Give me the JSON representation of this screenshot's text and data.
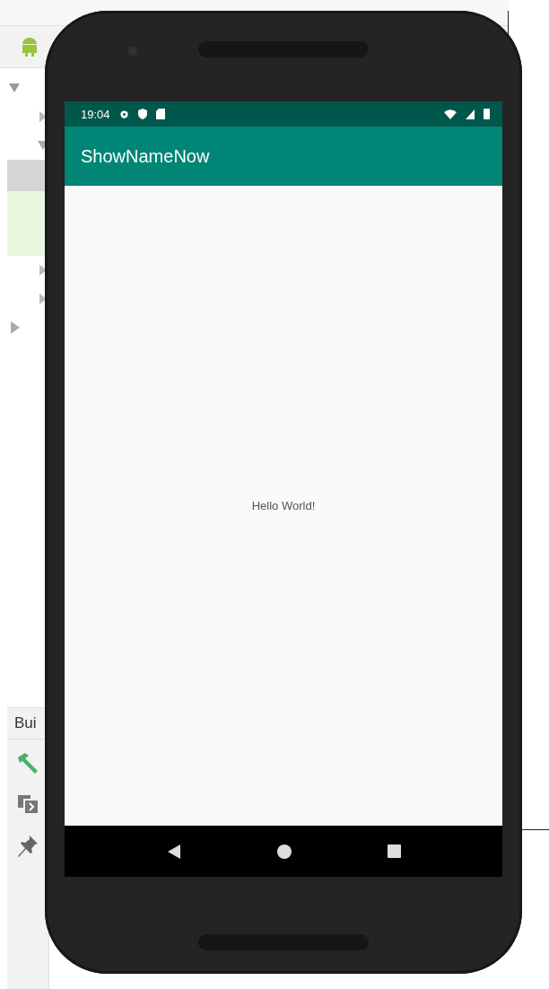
{
  "ide": {
    "build_tab": "Bui"
  },
  "status_bar": {
    "time": "19:04"
  },
  "app_bar": {
    "title": "ShowNameNow"
  },
  "content": {
    "text": "Hello World!"
  },
  "nav_buttons": [
    {
      "kind": "back"
    },
    {
      "kind": "home"
    },
    {
      "kind": "recents"
    }
  ]
}
